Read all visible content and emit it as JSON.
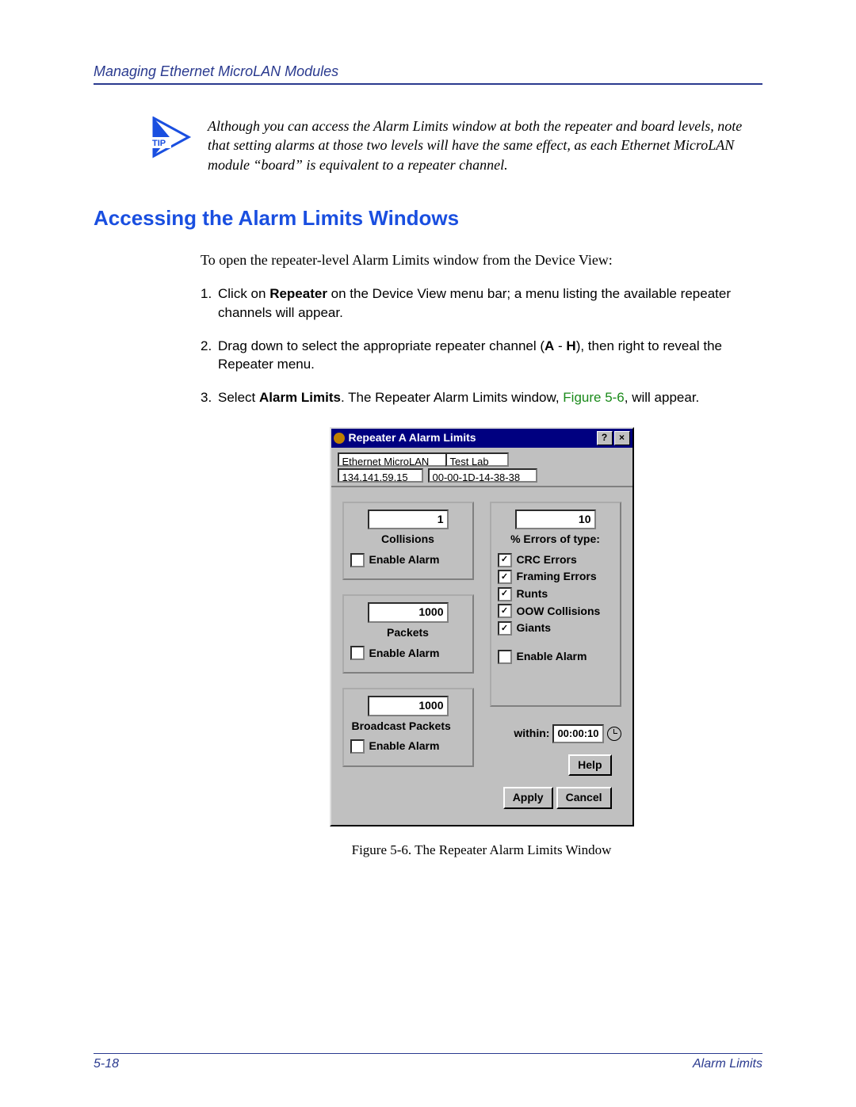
{
  "header": {
    "running_head": "Managing Ethernet MicroLAN Modules"
  },
  "tip": {
    "label": "TIP",
    "text": "Although you can access the Alarm Limits window at both the repeater and board levels, note that setting alarms at those two levels will have the same effect, as each Ethernet MicroLAN module “board” is equivalent to a repeater channel."
  },
  "section": {
    "title": "Accessing the Alarm Limits Windows"
  },
  "intro": "To open the repeater-level Alarm Limits window from the Device View:",
  "steps": [
    {
      "n": "1.",
      "pre": "Click on ",
      "b1": "Repeater",
      "post": " on the Device View menu bar; a menu listing the available repeater channels will appear."
    },
    {
      "n": "2.",
      "pre": "Drag down to select the appropriate repeater channel (",
      "b1": "A",
      "mid": " - ",
      "b2": "H",
      "post": "), then right to reveal the Repeater menu."
    },
    {
      "n": "3.",
      "pre": "Select ",
      "b1": "Alarm Limits",
      "mid": ". The Repeater Alarm Limits window, ",
      "link": "Figure 5-6",
      "post": ", will appear."
    }
  ],
  "window": {
    "title": "Repeater A Alarm Limits",
    "help_glyph": "?",
    "close_glyph": "×",
    "device_name": "Ethernet MicroLAN",
    "device_lab": "Test Lab",
    "ip": "134.141.59.15",
    "mac": "00-00-1D-14-38-38",
    "collisions": {
      "value": "1",
      "label": "Collisions",
      "enable": "Enable Alarm",
      "checked": false
    },
    "packets": {
      "value": "1000",
      "label": "Packets",
      "enable": "Enable Alarm",
      "checked": false
    },
    "broadcast": {
      "value": "1000",
      "label": "Broadcast Packets",
      "enable": "Enable Alarm",
      "checked": false
    },
    "errors": {
      "value": "10",
      "label": "% Errors of type:",
      "types": [
        {
          "label": "CRC Errors",
          "checked": true
        },
        {
          "label": "Framing Errors",
          "checked": true
        },
        {
          "label": "Runts",
          "checked": true
        },
        {
          "label": "OOW Collisions",
          "checked": true
        },
        {
          "label": "Giants",
          "checked": true
        }
      ],
      "enable": "Enable Alarm",
      "enable_checked": false
    },
    "within": {
      "label": "within:",
      "value": "00:00:10"
    },
    "buttons": {
      "help": "Help",
      "apply": "Apply",
      "cancel": "Cancel"
    }
  },
  "caption": "Figure 5-6.  The Repeater Alarm Limits Window",
  "footer": {
    "page": "5-18",
    "section": "Alarm Limits"
  }
}
